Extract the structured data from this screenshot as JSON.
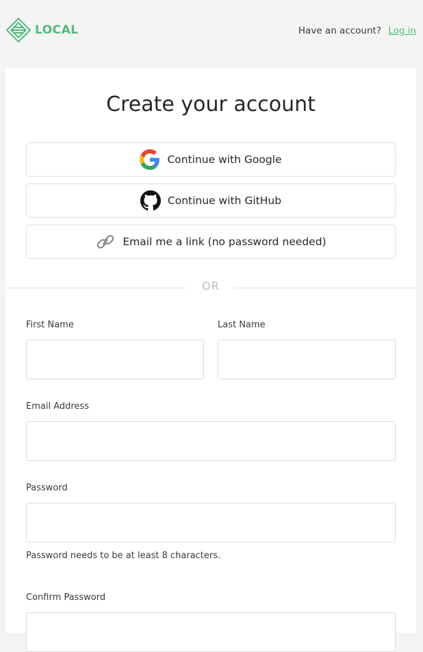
{
  "header": {
    "brand": "LOCAL",
    "account_prompt": "Have an account?",
    "login_link": "Log in"
  },
  "form": {
    "title": "Create your account",
    "google_button": "Continue with Google",
    "github_button": "Continue with GitHub",
    "email_link_button": "Email me a link (no password needed)",
    "divider_text": "OR",
    "first_name_label": "First Name",
    "first_name_value": "",
    "last_name_label": "Last Name",
    "last_name_value": "",
    "email_label": "Email Address",
    "email_value": "",
    "password_label": "Password",
    "password_value": "",
    "password_hint": "Password needs to be at least 8 characters.",
    "confirm_password_label": "Confirm Password",
    "confirm_password_value": ""
  },
  "colors": {
    "brand_green": "#51bb7b",
    "background": "#f4f4f4",
    "card": "#ffffff"
  },
  "icons": [
    "local-logo-icon",
    "google-icon",
    "github-icon",
    "link-icon"
  ]
}
